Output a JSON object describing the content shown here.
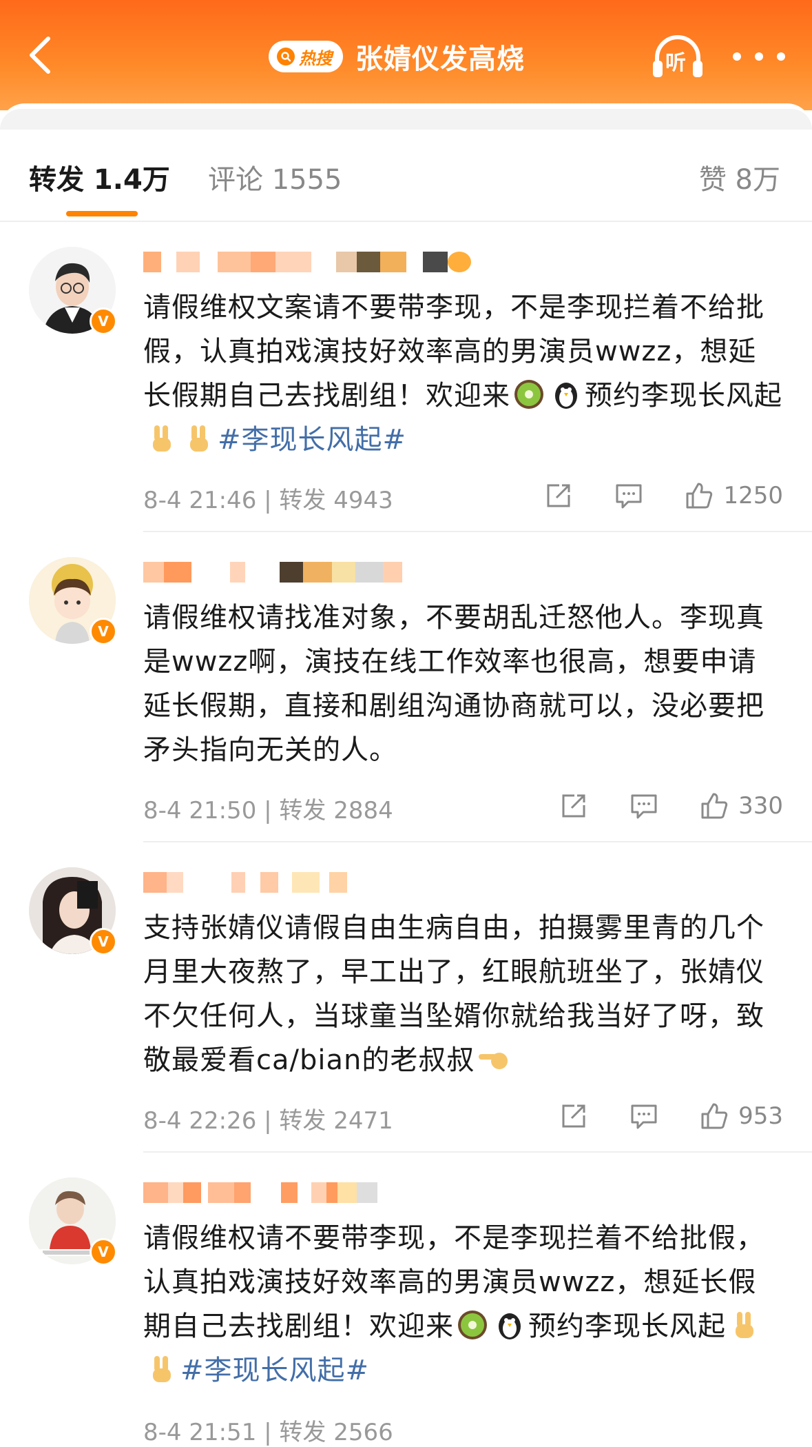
{
  "header": {
    "back_icon": "chevron-left-icon",
    "hot_badge": "热搜",
    "title": "张婧仪发高烧",
    "listen_label": "听",
    "more_icon": "more-dots-icon"
  },
  "tabs": {
    "repost": "转发 1.4万",
    "comment": "评论 1555",
    "like": "赞 8万"
  },
  "colors": {
    "accent": "#ff8200",
    "topic": "#436ea8",
    "muted": "#999999"
  },
  "comments": [
    {
      "text_a": "请假维权文案请不要带李现，不是李现拦着不给批假，认真拍戏演技好效率高的男演员wwzz，想延长假期自己去找剧组！欢迎来",
      "text_b": "预约李现长风起",
      "topic": "#李现长风起#",
      "meta": "8-4 21:46 | 转发 4943",
      "likes": "1250"
    },
    {
      "text": "请假维权请找准对象，不要胡乱迁怒他人。李现真是wwzz啊，演技在线工作效率也很高，想要申请延长假期，直接和剧组沟通协商就可以，没必要把矛头指向无关的人。",
      "meta": "8-4 21:50 | 转发 2884",
      "likes": "330"
    },
    {
      "text": "支持张婧仪请假自由生病自由，拍摄雾里青的几个月里大夜熬了，早工出了，红眼航班坐了，张婧仪不欠任何人，当球童当坠婿你就给我当好了呀，致敬最爱看ca/bian的老叔叔",
      "meta": "8-4 22:26 | 转发 2471",
      "likes": "953"
    },
    {
      "text_a": "请假维权请不要带李现，不是李现拦着不给批假，认真拍戏演技好效率高的男演员wwzz，想延长假期自己去找剧组！欢迎来",
      "text_b": "预约李现长风起",
      "topic": "#李现长风起#",
      "meta": "8-4 21:51 | 转发 2566"
    }
  ]
}
